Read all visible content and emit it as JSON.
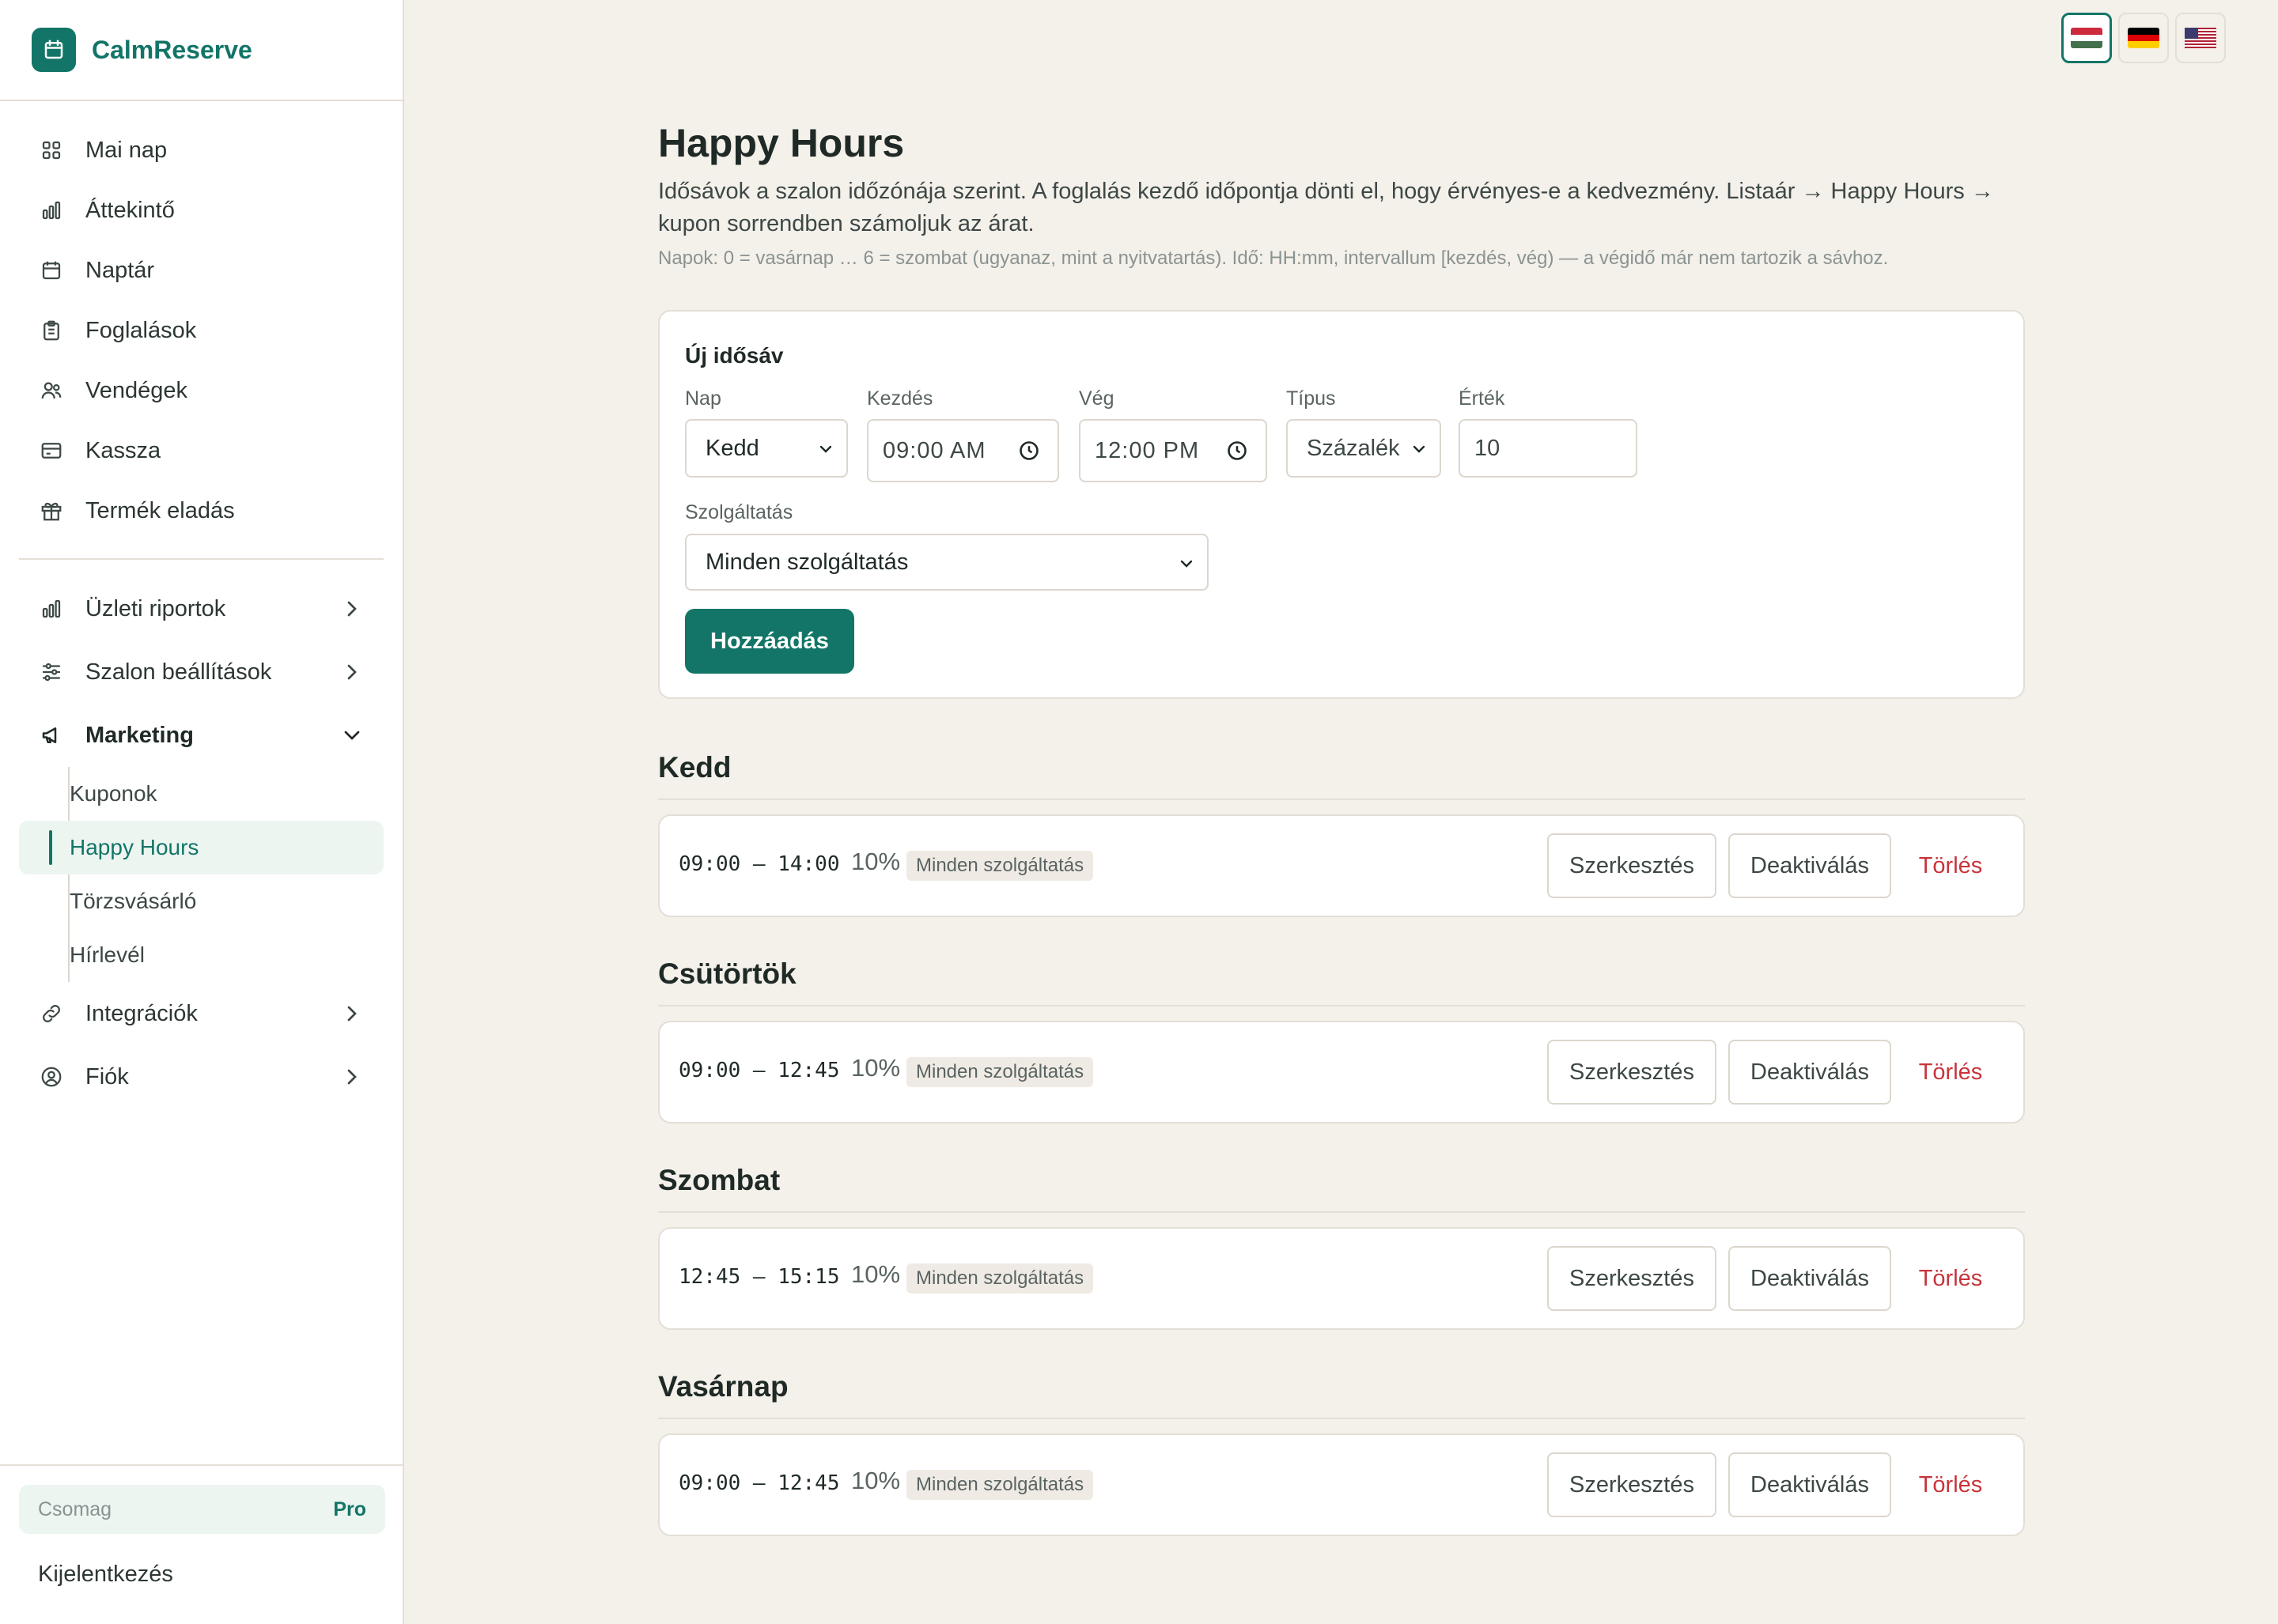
{
  "app": {
    "name": "CalmReserve"
  },
  "sidebar": {
    "items": [
      {
        "label": "Mai nap",
        "icon": "grid-icon"
      },
      {
        "label": "Áttekintő",
        "icon": "bar-chart-icon"
      },
      {
        "label": "Naptár",
        "icon": "calendar-icon"
      },
      {
        "label": "Foglalások",
        "icon": "clipboard-icon"
      },
      {
        "label": "Vendégek",
        "icon": "users-icon"
      },
      {
        "label": "Kassza",
        "icon": "credit-card-icon"
      },
      {
        "label": "Termék eladás",
        "icon": "gift-icon"
      }
    ],
    "groups": [
      {
        "label": "Üzleti riportok",
        "icon": "bar-chart-icon"
      },
      {
        "label": "Szalon beállítások",
        "icon": "sliders-icon"
      },
      {
        "label": "Marketing",
        "icon": "megaphone-icon"
      },
      {
        "label": "Integrációk",
        "icon": "link-icon"
      },
      {
        "label": "Fiók",
        "icon": "user-circle-icon"
      }
    ],
    "marketing_sub": [
      "Kuponok",
      "Happy Hours",
      "Törzsvásárló",
      "Hírlevél"
    ],
    "plan": {
      "label": "Csomag",
      "value": "Pro"
    },
    "logout": "Kijelentkezés"
  },
  "languages": [
    "hu",
    "de",
    "en-US"
  ],
  "page": {
    "title": "Happy Hours",
    "description": "Idősávok a szalon időzónája szerint. A foglalás kezdő időpontja dönti el, hogy érvényes-e a kedvezmény. Listaár → Happy Hours → kupon sorrendben számoljuk az árat.",
    "hint": "Napok: 0 = vasárnap … 6 = szombat (ugyanaz, mint a nyitvatartás). Idő: HH:mm, intervallum [kezdés, vég) — a végidő már nem tartozik a sávhoz."
  },
  "form": {
    "title": "Új idősáv",
    "day_label": "Nap",
    "day_value": "Kedd",
    "start_label": "Kezdés",
    "start_value": "09:00 AM",
    "end_label": "Vég",
    "end_value": "12:00 PM",
    "type_label": "Típus",
    "type_value": "Százalék",
    "value_label": "Érték",
    "value_value": "10",
    "service_label": "Szolgáltatás",
    "service_value": "Minden szolgáltatás",
    "add_button": "Hozzáadás"
  },
  "actions": {
    "edit": "Szerkesztés",
    "deactivate": "Deaktiválás",
    "delete": "Törlés"
  },
  "days": [
    {
      "name": "Kedd",
      "slots": [
        {
          "time": "09:00 – 14:00",
          "pct": "10%",
          "service": "Minden szolgáltatás"
        }
      ]
    },
    {
      "name": "Csütörtök",
      "slots": [
        {
          "time": "09:00 – 12:45",
          "pct": "10%",
          "service": "Minden szolgáltatás"
        }
      ]
    },
    {
      "name": "Szombat",
      "slots": [
        {
          "time": "12:45 – 15:15",
          "pct": "10%",
          "service": "Minden szolgáltatás"
        }
      ]
    },
    {
      "name": "Vasárnap",
      "slots": [
        {
          "time": "09:00 – 12:45",
          "pct": "10%",
          "service": "Minden szolgáltatás"
        }
      ]
    }
  ],
  "colors": {
    "accent": "#127567",
    "danger": "#c8333a",
    "background": "#f4f0ea"
  }
}
